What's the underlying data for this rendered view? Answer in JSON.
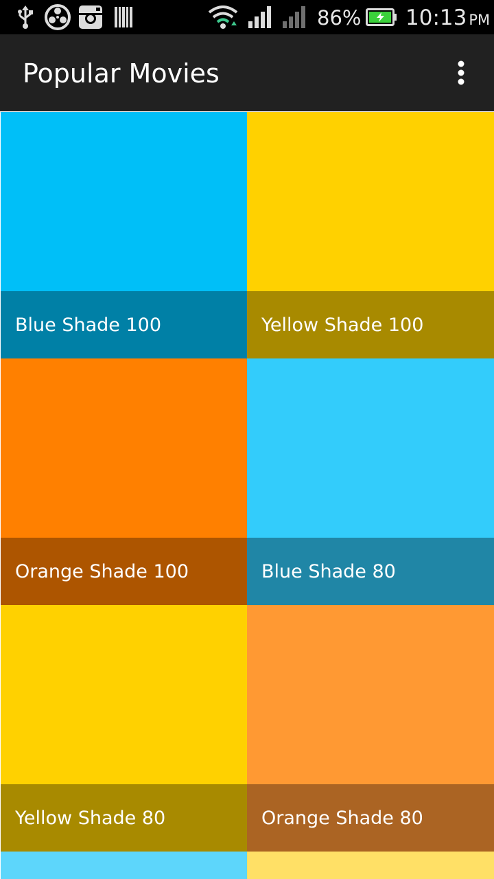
{
  "status_bar": {
    "battery_percent": "86%",
    "time": "10:13",
    "ampm": "PM",
    "icons": [
      "usb-icon",
      "media-icon",
      "instagram-icon",
      "barcode-icon",
      "wifi-icon",
      "signal-icon",
      "signal-secondary-icon",
      "battery-charging-icon"
    ],
    "colors": {
      "background": "#000000",
      "battery_green": "#3bd13b"
    }
  },
  "app_bar": {
    "title": "Popular Movies",
    "overflow_icon": "more-vert-icon",
    "background": "#212121"
  },
  "grid": {
    "columns": 2,
    "tiles": [
      {
        "label": "Blue Shade 100",
        "image_color": "#00bff8",
        "footer_color": "#0080a6"
      },
      {
        "label": "Yellow Shade 100",
        "image_color": "#ffd100",
        "footer_color": "#a88a00"
      },
      {
        "label": "Orange Shade 100",
        "image_color": "#ff8000",
        "footer_color": "#ad5500"
      },
      {
        "label": "Blue Shade 80",
        "image_color": "#33ccfb",
        "footer_color": "#2086a6"
      },
      {
        "label": "Yellow Shade 80",
        "image_color": "#ffd100",
        "footer_color": "#a88a00"
      },
      {
        "label": "Orange Shade 80",
        "image_color": "#ff9933",
        "footer_color": "#ab6423"
      }
    ],
    "partial_row": [
      {
        "image_color": "#5dd6fb"
      },
      {
        "image_color": "#ffe066"
      }
    ]
  }
}
